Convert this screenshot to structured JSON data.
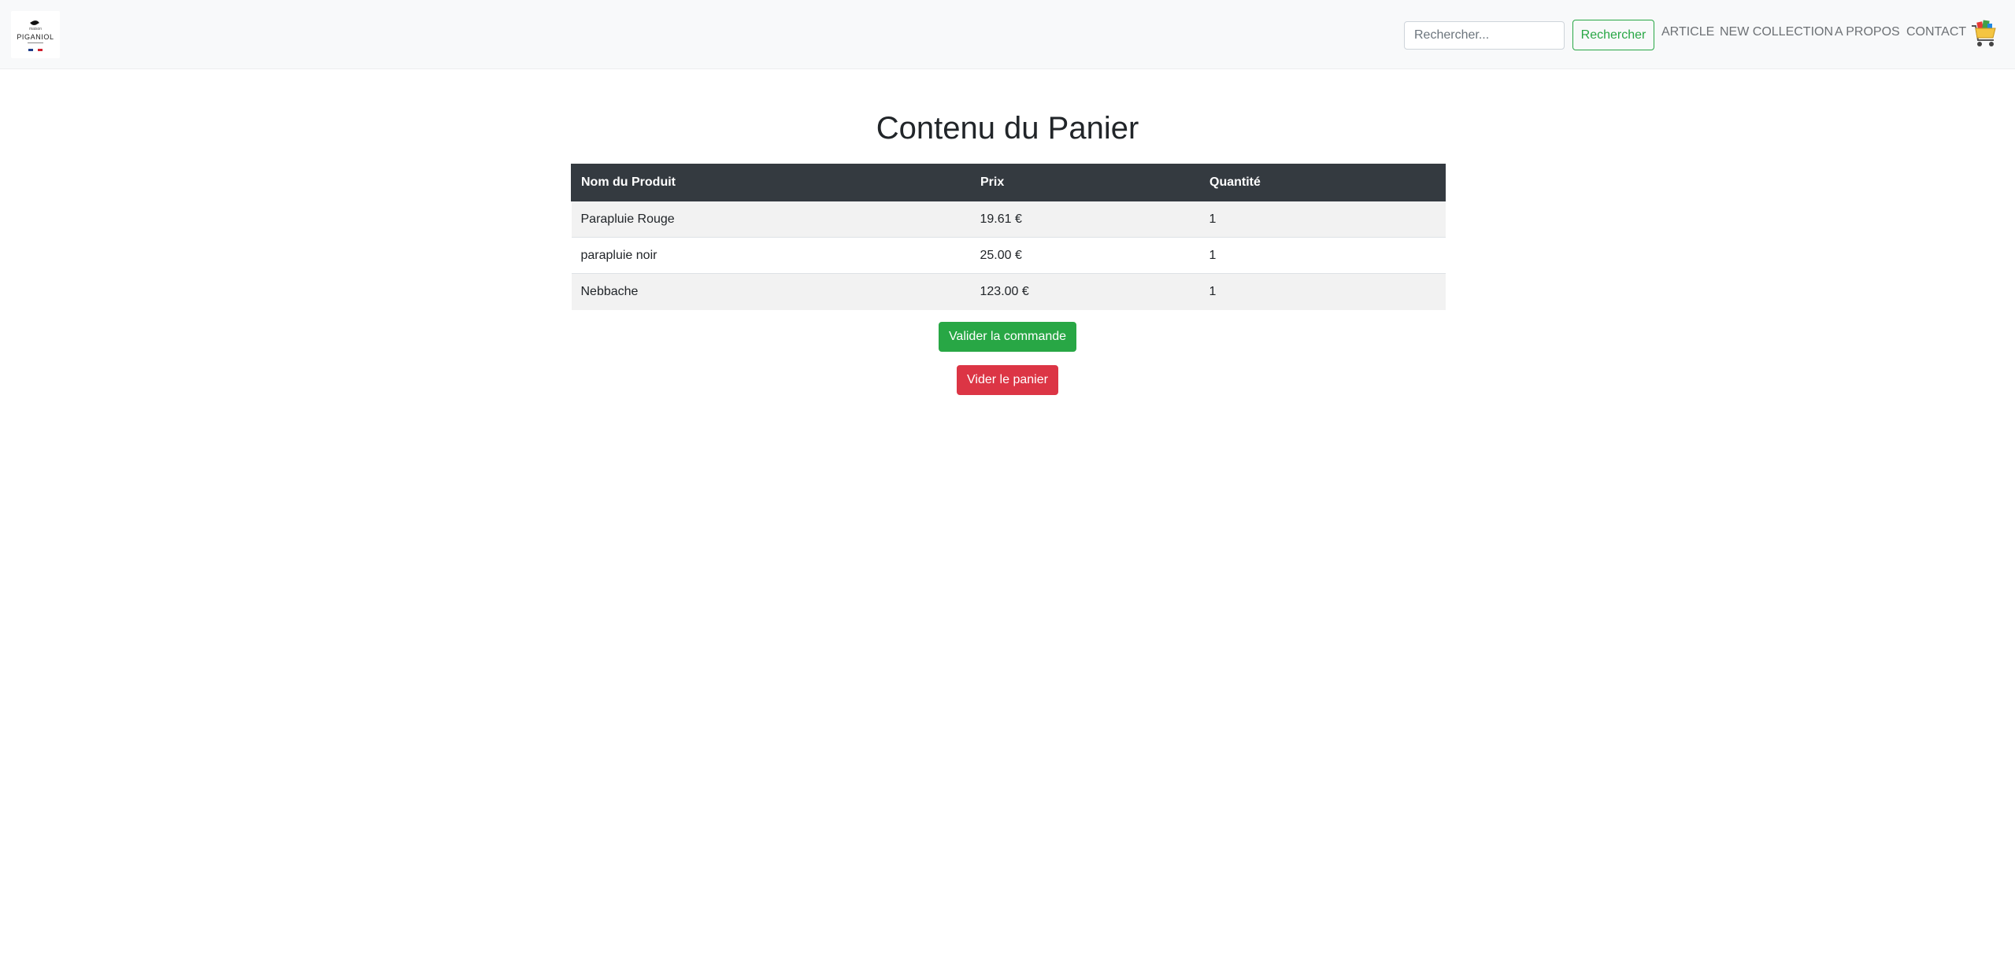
{
  "header": {
    "logo": {
      "brand": "PIGANIOL",
      "tagline": "maison",
      "icon": "leaf-icon"
    },
    "search": {
      "placeholder": "Rechercher...",
      "value": "",
      "button_label": "Rechercher"
    },
    "nav": {
      "items": [
        {
          "label": "ARTICLE"
        },
        {
          "label": "NEW COLLECTION"
        },
        {
          "label": "A PROPOS"
        },
        {
          "label": "CONTACT"
        }
      ]
    },
    "cart_icon": "shopping-cart-icon"
  },
  "main": {
    "title": "Contenu du Panier",
    "table": {
      "columns": [
        "Nom du Produit",
        "Prix",
        "Quantité"
      ],
      "rows": [
        {
          "name": "Parapluie Rouge",
          "price": "19.61 €",
          "quantity": "1"
        },
        {
          "name": "parapluie noir",
          "price": "25.00 €",
          "quantity": "1"
        },
        {
          "name": "Nebbache",
          "price": "123.00 €",
          "quantity": "1"
        }
      ]
    },
    "actions": {
      "validate_label": "Valider la commande",
      "empty_label": "Vider le panier"
    }
  },
  "colors": {
    "navbar_bg": "#f8f9fa",
    "table_header_bg": "#343a40",
    "success": "#28a745",
    "danger": "#dc3545",
    "cart_basket": "#f4c542",
    "cart_handle": "#e53935"
  }
}
